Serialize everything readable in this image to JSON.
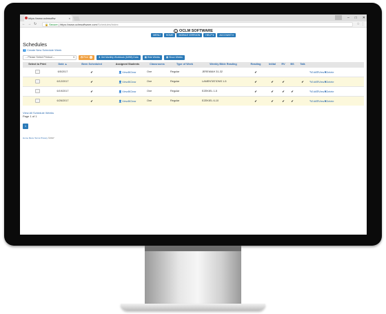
{
  "browser": {
    "tab_title": "https://www.oclmsoftw",
    "tab_close": "×",
    "window_min": "–",
    "window_max": "□",
    "window_close": "✕",
    "secure_label": "Secure",
    "url_host": "https://www.oclmsoftware.com",
    "url_path": "/Schedules/Index",
    "star_icon": "☆",
    "menu_icon": "⋮"
  },
  "site": {
    "logo_text": "OCLM SOFTWARE",
    "logo_mark": "1",
    "menu": [
      "MENU",
      "HOME",
      "MOBILE VERSION",
      "HELP ▾",
      "ACCOUNT ▾"
    ]
  },
  "schedules": {
    "title": "Schedules",
    "create_link": "Create New Schedule Week",
    "select_placeholder": "-- Please Select Printout --",
    "buttons": {
      "print": "Print",
      "print_badge": "0",
      "workbook": "Get Monthly Workbook (MWB) Data",
      "hide_weeks": "Hide Weeks",
      "show_weeks": "Show Weeks"
    },
    "columns": [
      "Select to Print",
      "Date ▲",
      "Been Scheduled",
      "Assigned Students",
      "Classrooms",
      "Type of Week",
      "Weekly Bible Reading",
      "Reading",
      "Initial",
      "RV",
      "BS",
      "Talk",
      ""
    ],
    "rows": [
      {
        "date": "6/5/2017",
        "scheduled": "✔",
        "students": "View|Clear",
        "classrooms": "One",
        "type": "Regular",
        "reading_ref": "JEREMIAH 31-32",
        "reading": "✔",
        "initial": "",
        "rv": "",
        "bs": "",
        "talk": "",
        "actions": "Edit|View|Delete"
      },
      {
        "date": "6/12/2017",
        "scheduled": "✔",
        "students": "View|Clear",
        "classrooms": "One",
        "type": "Regular",
        "reading_ref": "LAMENTATIONS 1-5",
        "reading": "✔",
        "initial": "✔",
        "rv": "✔",
        "bs": "",
        "talk": "✔",
        "actions": "Edit|View|Delete"
      },
      {
        "date": "6/19/2017",
        "scheduled": "✔",
        "students": "View|Clear",
        "classrooms": "One",
        "type": "Regular",
        "reading_ref": "EZEKIEL 1-5",
        "reading": "✔",
        "initial": "✔",
        "rv": "✔",
        "bs": "✔",
        "talk": "",
        "actions": "Edit|View|Delete"
      },
      {
        "date": "6/26/2017",
        "scheduled": "✔",
        "students": "View|Clear",
        "classrooms": "One",
        "type": "Regular",
        "reading_ref": "EZEKIEL 6-10",
        "reading": "✔",
        "initial": "✔",
        "rv": "✔",
        "bs": "✔",
        "talk": "",
        "actions": "Edit|View|Delete"
      }
    ],
    "view_all_link": "View All Schedule Weeks",
    "page_info": "Page 1 of 1",
    "page_button": "1",
    "footer_links": "Home Menu Terms Privacy",
    "footer_copy": "©2017"
  },
  "colors": {
    "accent": "#2a7ab8",
    "print": "#f0a040",
    "row_highlight": "#fcf8dc"
  }
}
